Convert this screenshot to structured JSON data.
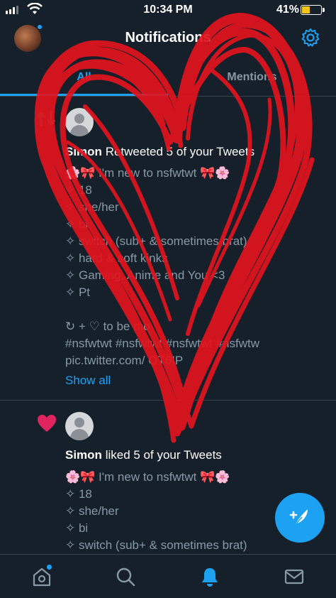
{
  "status_bar": {
    "time": "10:34 PM",
    "battery": "41%",
    "battery_level": 0.41
  },
  "header": {
    "title": "Notifications"
  },
  "tabs": [
    {
      "label": "All"
    },
    {
      "label": "Mentions"
    }
  ],
  "notifications": [
    {
      "user": "Simon",
      "action": "Retweeted 5 of your Tweets",
      "lines": [
        "🌸🎀 I'm new to nsfwtwt 🎀🌸",
        "✧ 18",
        "✧ she/her",
        "✧ bi",
        "✧ switch (sub+ & sometimes brat)",
        "✧ hard & soft kinks",
        "✧ Gaming, Anime and You <3",
        "✧ Pt",
        "",
        "↻ + ♡ to be mo",
        "#nsfwtwt #nsfwtwt #nsfwtwt #nsfwtw",
        "pic.twitter.com/          OT6IP"
      ],
      "show_all": "Show all"
    },
    {
      "user": "Simon",
      "action": "liked 5 of your Tweets",
      "lines": [
        "🌸🎀 I'm new to nsfwtwt 🎀🌸",
        "✧ 18",
        "✧ she/her",
        "✧ bi",
        "✧ switch (sub+ & sometimes brat)"
      ]
    }
  ],
  "colors": {
    "accent": "#1da1f2",
    "background": "#15202b",
    "like": "#e0245e",
    "retweet": "#17bf63",
    "scribble": "#e3141e"
  }
}
